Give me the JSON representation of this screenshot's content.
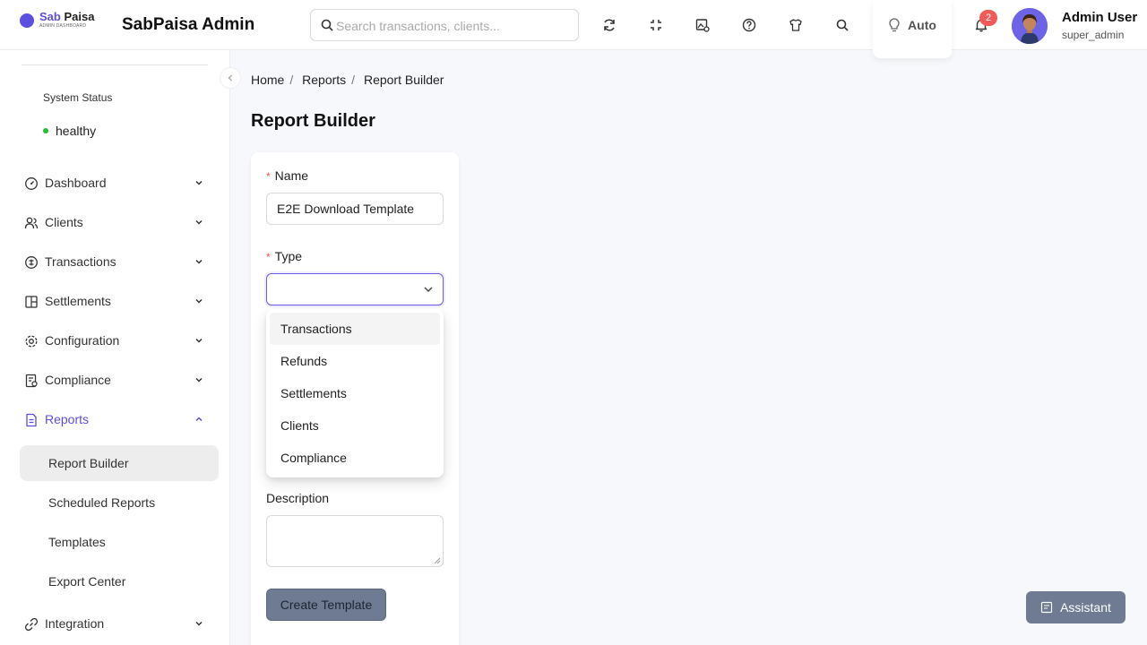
{
  "brand": {
    "logo_main_a": "Sab",
    "logo_main_b": "Paisa",
    "logo_sub": "ADMIN DASHBOARD",
    "app_title": "SabPaisa Admin"
  },
  "search": {
    "placeholder": "Search transactions, clients..."
  },
  "header": {
    "icons": [
      "refresh-icon",
      "fullscreen-icon",
      "image-settings-icon",
      "help-icon",
      "shirt-icon",
      "search-icon"
    ],
    "theme_label": "Auto",
    "notification_count": "2",
    "user_name": "Admin User",
    "user_role": "super_admin"
  },
  "sidebar": {
    "system_status_label": "System Status",
    "system_status_value": "healthy",
    "items": [
      {
        "label": "Dashboard",
        "icon": "dashboard-icon"
      },
      {
        "label": "Clients",
        "icon": "users-icon"
      },
      {
        "label": "Transactions",
        "icon": "transactions-icon"
      },
      {
        "label": "Settlements",
        "icon": "settlements-icon"
      },
      {
        "label": "Configuration",
        "icon": "gear-icon"
      },
      {
        "label": "Compliance",
        "icon": "compliance-icon"
      },
      {
        "label": "Reports",
        "icon": "report-icon"
      },
      {
        "label": "Integration",
        "icon": "integration-icon"
      }
    ],
    "reports_subitems": [
      "Report Builder",
      "Scheduled Reports",
      "Templates",
      "Export Center"
    ]
  },
  "breadcrumb": [
    "Home",
    "Reports",
    "Report Builder"
  ],
  "page_title": "Report Builder",
  "form": {
    "name_label": "Name",
    "name_value": "E2E Download Template",
    "type_label": "Type",
    "type_options": [
      "Transactions",
      "Refunds",
      "Settlements",
      "Clients",
      "Compliance"
    ],
    "description_label": "Description",
    "create_button": "Create Template"
  },
  "assistant_button": "Assistant",
  "colors": {
    "accent": "#5b4fe0",
    "button": "#6e7b93",
    "status_ok": "#20c030",
    "badge": "#f25a5a"
  }
}
